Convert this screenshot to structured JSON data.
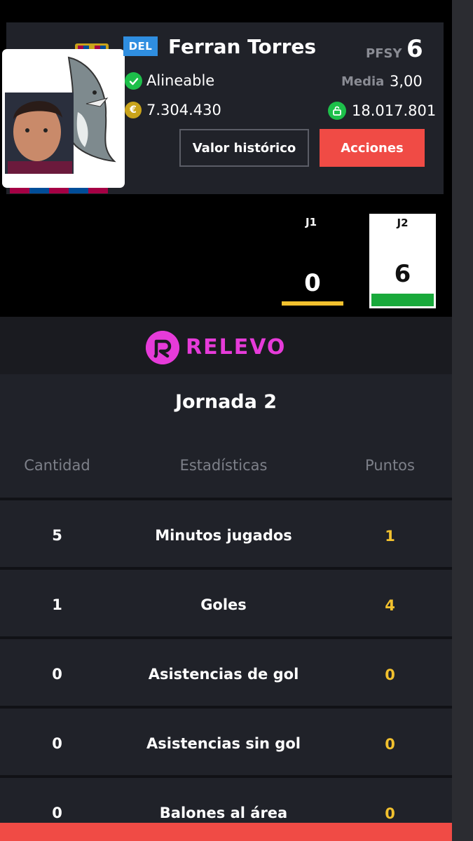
{
  "player": {
    "position_badge": "DEL",
    "name": "Ferran Torres",
    "pfsy_label": "PFSY",
    "pfsy_value": "6",
    "status": "Alineable",
    "media_label": "Media",
    "media_value": "3,00",
    "market_value": "7.304.430",
    "clause_value": "18.017.801",
    "coin_icon_glyph": "€"
  },
  "buttons": {
    "historico": "Valor histórico",
    "acciones": "Acciones"
  },
  "jornadas": [
    {
      "label": "J1",
      "score": "0"
    },
    {
      "label": "J2",
      "score": "6"
    }
  ],
  "brand": {
    "name": "RELEVO",
    "color": "#e63bd9"
  },
  "stats": {
    "title": "Jornada 2",
    "headers": {
      "cantidad": "Cantidad",
      "estadisticas": "Estadísticas",
      "puntos": "Puntos"
    },
    "rows": [
      {
        "cantidad": "5",
        "estadistica": "Minutos jugados",
        "puntos": "1"
      },
      {
        "cantidad": "1",
        "estadistica": "Goles",
        "puntos": "4"
      },
      {
        "cantidad": "0",
        "estadistica": "Asistencias de gol",
        "puntos": "0"
      },
      {
        "cantidad": "0",
        "estadistica": "Asistencias sin gol",
        "puntos": "0"
      },
      {
        "cantidad": "0",
        "estadistica": "Balones al área",
        "puntos": "0"
      }
    ]
  },
  "colors": {
    "accent_red": "#f04b45",
    "points_yellow": "#f2c12e",
    "ok_green": "#1dbf4a",
    "badge_blue": "#2f8ee0"
  }
}
